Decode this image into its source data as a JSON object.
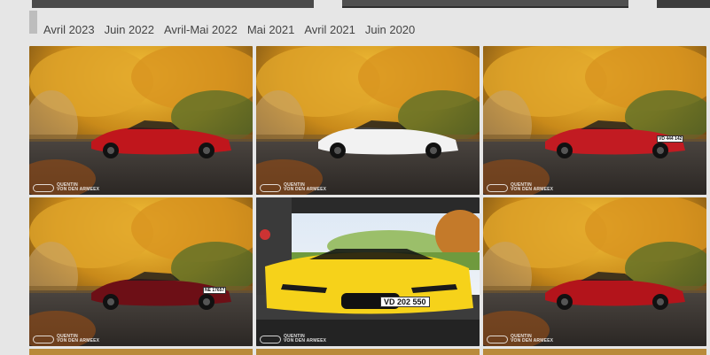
{
  "tabs": [
    "Avril 2023",
    "Juin 2022",
    "Avril-Mai 2022",
    "Mai 2021",
    "Avril 2021",
    "Juin 2020"
  ],
  "watermark": {
    "line1": "QUENTIN",
    "line2": "VON DEN ARMEEX"
  },
  "photos": [
    {
      "car_color": "#c0161c",
      "plate": "",
      "scene": "autumn"
    },
    {
      "car_color": "#f2f2f2",
      "plate": "",
      "scene": "autumn"
    },
    {
      "car_color": "#c21b22",
      "plate": "VD 444 142",
      "scene": "autumn"
    },
    {
      "car_color": "#6d0f16",
      "plate": "NE 17657",
      "scene": "autumn"
    },
    {
      "car_color": "#f6d21a",
      "plate": "VD 202 550",
      "scene": "garage"
    },
    {
      "car_color": "#b3141b",
      "plate": "",
      "scene": "autumn"
    }
  ],
  "colors": {
    "background": "#e6e6e6",
    "tab_text": "#444444",
    "topbar": "#4a4a4a"
  }
}
